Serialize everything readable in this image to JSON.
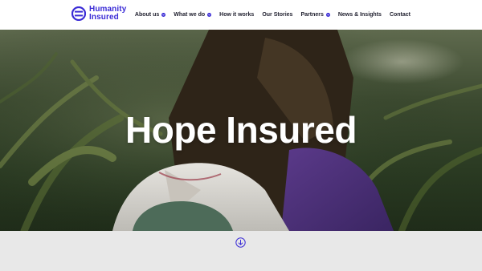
{
  "brand": {
    "name_line1": "Humanity",
    "name_line2": "Insured",
    "icon": "humanity-insured-logo",
    "color": "#3a2bd6"
  },
  "nav": {
    "items": [
      {
        "label": "About us",
        "has_dropdown": true
      },
      {
        "label": "What we do",
        "has_dropdown": true
      },
      {
        "label": "How it works",
        "has_dropdown": false
      },
      {
        "label": "Our Stories",
        "has_dropdown": false
      },
      {
        "label": "Partners",
        "has_dropdown": true
      },
      {
        "label": "News & Insights",
        "has_dropdown": false
      },
      {
        "label": "Contact",
        "has_dropdown": false
      }
    ],
    "dropdown_icon": "chevron-down-icon"
  },
  "hero": {
    "title": "Hope Insured",
    "image": "woman-and-child-in-corn-field"
  },
  "scroll": {
    "icon": "arrow-down-circle-icon",
    "color": "#3a2bd6"
  }
}
